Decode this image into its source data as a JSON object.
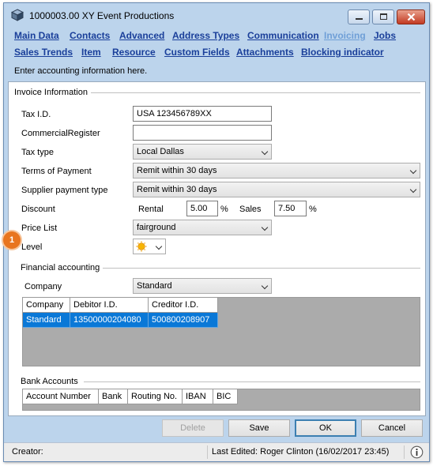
{
  "window": {
    "title": "1000003.00 XY Event Productions"
  },
  "nav": {
    "row1": [
      {
        "label": "Main Data",
        "active": false
      },
      {
        "label": "Contacts",
        "active": false
      },
      {
        "label": "Advanced",
        "active": false
      },
      {
        "label": "Address Types",
        "active": false
      },
      {
        "label": "Communication",
        "active": false
      },
      {
        "label": "Invoicing",
        "active": true
      },
      {
        "label": "Jobs",
        "active": false
      }
    ],
    "row2": [
      {
        "label": "Sales Trends"
      },
      {
        "label": "Item"
      },
      {
        "label": "Resource"
      },
      {
        "label": "Custom Fields"
      },
      {
        "label": "Attachments"
      },
      {
        "label": "Blocking indicator"
      }
    ]
  },
  "hint": "Enter accounting information here.",
  "invoice": {
    "section_title": "Invoice Information",
    "tax_id_label": "Tax I.D.",
    "tax_id_value": "USA 123456789XX",
    "commercial_register_label": "CommercialRegister",
    "commercial_register_value": "",
    "tax_type_label": "Tax type",
    "tax_type_value": "Local Dallas",
    "terms_label": "Terms of Payment",
    "terms_value": "Remit within 30 days",
    "supplier_payment_label": "Supplier payment type",
    "supplier_payment_value": "Remit within 30 days",
    "discount_label": "Discount",
    "rental_label": "Rental",
    "rental_value": "5.00",
    "rental_unit": "%",
    "sales_label": "Sales",
    "sales_value": "7.50",
    "sales_unit": "%",
    "price_list_label": "Price List",
    "price_list_value": "fairground",
    "level_label": "Level",
    "level_icon": "sun-icon",
    "callout_number": "1"
  },
  "financial": {
    "section_title": "Financial accounting",
    "company_label": "Company",
    "company_value": "Standard",
    "columns": [
      "Company",
      "Debitor I.D.",
      "Creditor I.D."
    ],
    "rows": [
      [
        "Standard",
        "13500000204080",
        "500800208907"
      ]
    ]
  },
  "bank": {
    "section_title": "Bank Accounts",
    "columns": [
      "Account Number",
      "Bank",
      "Routing No.",
      "IBAN",
      "BIC"
    ]
  },
  "buttons": {
    "delete": "Delete",
    "save": "Save",
    "ok": "OK",
    "cancel": "Cancel"
  },
  "status": {
    "creator_label": "Creator:",
    "last_edited": "Last Edited:  Roger Clinton (16/02/2017 23:45)"
  },
  "colors": {
    "window_bg": "#bcd4ec",
    "link": "#1a3f9a",
    "active_link": "#6f9fd7",
    "selection": "#0a78d7",
    "callout": "#e8751f"
  }
}
